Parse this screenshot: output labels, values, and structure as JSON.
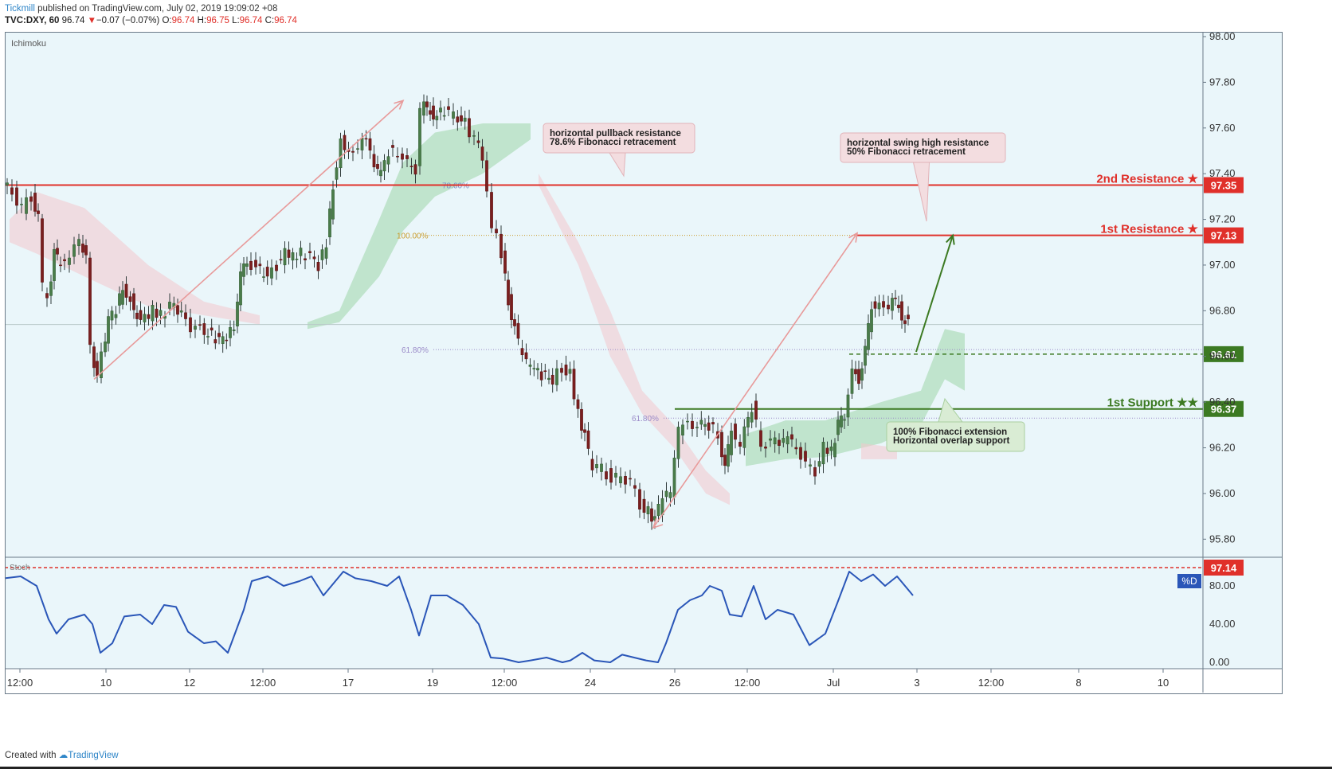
{
  "header": {
    "publisher": "Tickmill",
    "published_text": " published on TradingView.com, July 02, 2019 19:09:02 +08",
    "symbol": "TVC:DXY, 60",
    "last": "96.74",
    "arrow": "▼",
    "change": "−0.07 (−0.07%)",
    "o_label": "O:",
    "o_value": "96.74",
    "h_label": "H:",
    "h_value": "96.75",
    "l_label": "L:",
    "l_value": "96.74",
    "c_label": "C:",
    "c_value": "96.74"
  },
  "chart_data": {
    "type": "candlestick",
    "indicator_label": "Ichimoku",
    "ylim": [
      95.7,
      98.0
    ],
    "y_ticks": [
      "98.00",
      "97.80",
      "97.60",
      "97.40",
      "97.20",
      "97.00",
      "96.80",
      "96.60",
      "96.40",
      "96.20",
      "96.00",
      "95.80"
    ],
    "x_ticks": [
      "12:00",
      "10",
      "12",
      "12:00",
      "17",
      "19",
      "12:00",
      "24",
      "26",
      "12:00",
      "Jul",
      "3",
      "12:00",
      "8",
      "10"
    ],
    "series_path": [
      [
        0,
        97.35
      ],
      [
        12,
        97.32
      ],
      [
        24,
        97.25
      ],
      [
        36,
        97.3
      ],
      [
        44,
        97.2
      ],
      [
        50,
        96.9
      ],
      [
        56,
        96.85
      ],
      [
        64,
        97.05
      ],
      [
        72,
        97.0
      ],
      [
        84,
        97.05
      ],
      [
        96,
        97.1
      ],
      [
        104,
        97.05
      ],
      [
        110,
        96.65
      ],
      [
        118,
        96.5
      ],
      [
        124,
        96.6
      ],
      [
        132,
        96.75
      ],
      [
        142,
        96.8
      ],
      [
        150,
        96.9
      ],
      [
        160,
        96.85
      ],
      [
        168,
        96.78
      ],
      [
        178,
        96.76
      ],
      [
        188,
        96.8
      ],
      [
        198,
        96.78
      ],
      [
        210,
        96.82
      ],
      [
        224,
        96.8
      ],
      [
        236,
        96.73
      ],
      [
        248,
        96.72
      ],
      [
        262,
        96.69
      ],
      [
        276,
        96.67
      ],
      [
        290,
        96.72
      ],
      [
        298,
        96.95
      ],
      [
        306,
        97.03
      ],
      [
        318,
        96.98
      ],
      [
        332,
        96.96
      ],
      [
        344,
        97.0
      ],
      [
        354,
        97.05
      ],
      [
        364,
        97.03
      ],
      [
        374,
        97.05
      ],
      [
        386,
        97.03
      ],
      [
        396,
        97.0
      ],
      [
        406,
        97.1
      ],
      [
        414,
        97.35
      ],
      [
        424,
        97.55
      ],
      [
        434,
        97.5
      ],
      [
        446,
        97.52
      ],
      [
        456,
        97.55
      ],
      [
        466,
        97.42
      ],
      [
        474,
        97.4
      ],
      [
        484,
        97.5
      ],
      [
        496,
        97.5
      ],
      [
        508,
        97.44
      ],
      [
        518,
        97.42
      ],
      [
        524,
        97.68
      ],
      [
        532,
        97.7
      ],
      [
        540,
        97.65
      ],
      [
        554,
        97.67
      ],
      [
        566,
        97.66
      ],
      [
        580,
        97.62
      ],
      [
        592,
        97.55
      ],
      [
        602,
        97.48
      ],
      [
        608,
        97.3
      ],
      [
        614,
        97.15
      ],
      [
        620,
        97.16
      ],
      [
        626,
        97.05
      ],
      [
        634,
        96.85
      ],
      [
        642,
        96.72
      ],
      [
        652,
        96.6
      ],
      [
        662,
        96.55
      ],
      [
        676,
        96.52
      ],
      [
        690,
        96.5
      ],
      [
        702,
        96.55
      ],
      [
        712,
        96.52
      ],
      [
        722,
        96.35
      ],
      [
        730,
        96.25
      ],
      [
        740,
        96.1
      ],
      [
        752,
        96.12
      ],
      [
        764,
        96.05
      ],
      [
        776,
        96.08
      ],
      [
        788,
        96.05
      ],
      [
        800,
        95.95
      ],
      [
        810,
        95.92
      ],
      [
        818,
        95.88
      ],
      [
        828,
        95.98
      ],
      [
        838,
        96.0
      ],
      [
        848,
        96.28
      ],
      [
        860,
        96.3
      ],
      [
        872,
        96.3
      ],
      [
        886,
        96.3
      ],
      [
        898,
        96.26
      ],
      [
        906,
        96.1
      ],
      [
        914,
        96.28
      ],
      [
        926,
        96.22
      ],
      [
        940,
        96.38
      ],
      [
        952,
        96.22
      ],
      [
        964,
        96.22
      ],
      [
        980,
        96.24
      ],
      [
        996,
        96.22
      ],
      [
        1008,
        96.12
      ],
      [
        1020,
        96.1
      ],
      [
        1030,
        96.2
      ],
      [
        1040,
        96.18
      ],
      [
        1048,
        96.3
      ],
      [
        1056,
        96.33
      ],
      [
        1066,
        96.56
      ],
      [
        1074,
        96.5
      ],
      [
        1082,
        96.62
      ],
      [
        1090,
        96.82
      ],
      [
        1100,
        96.84
      ],
      [
        1112,
        96.82
      ],
      [
        1120,
        96.85
      ],
      [
        1128,
        96.78
      ],
      [
        1136,
        96.74
      ]
    ],
    "cloud_bands": [
      {
        "name": "green cloud 1",
        "color": "#9cd6a8",
        "upper": [
          [
            380,
            96.75
          ],
          [
            420,
            96.8
          ],
          [
            470,
            97.2
          ],
          [
            500,
            97.45
          ],
          [
            540,
            97.58
          ],
          [
            600,
            97.62
          ],
          [
            660,
            97.62
          ]
        ],
        "lower": [
          [
            380,
            96.72
          ],
          [
            420,
            96.75
          ],
          [
            470,
            96.95
          ],
          [
            500,
            97.15
          ],
          [
            540,
            97.3
          ],
          [
            600,
            97.4
          ],
          [
            660,
            97.55
          ]
        ]
      },
      {
        "name": "green cloud 2",
        "color": "#9cd6a8",
        "upper": [
          [
            930,
            96.26
          ],
          [
            980,
            96.32
          ],
          [
            1030,
            96.32
          ],
          [
            1100,
            96.4
          ],
          [
            1150,
            96.45
          ],
          [
            1180,
            96.72
          ],
          [
            1205,
            96.7
          ]
        ],
        "lower": [
          [
            930,
            96.12
          ],
          [
            980,
            96.15
          ],
          [
            1030,
            96.16
          ],
          [
            1100,
            96.22
          ],
          [
            1150,
            96.3
          ],
          [
            1180,
            96.5
          ],
          [
            1205,
            96.45
          ]
        ]
      },
      {
        "name": "red cloud 1",
        "color": "#f2c6cc",
        "upper": [
          [
            6,
            97.2
          ],
          [
            40,
            97.32
          ],
          [
            100,
            97.25
          ],
          [
            180,
            97.0
          ],
          [
            250,
            96.84
          ],
          [
            320,
            96.78
          ]
        ],
        "lower": [
          [
            6,
            97.1
          ],
          [
            40,
            97.05
          ],
          [
            100,
            96.95
          ],
          [
            180,
            96.82
          ],
          [
            250,
            96.78
          ],
          [
            320,
            96.74
          ]
        ]
      },
      {
        "name": "red cloud 2",
        "color": "#f2c6cc",
        "upper": [
          [
            670,
            97.4
          ],
          [
            720,
            97.1
          ],
          [
            760,
            96.8
          ],
          [
            800,
            96.45
          ],
          [
            840,
            96.3
          ],
          [
            880,
            96.1
          ],
          [
            910,
            96.0
          ]
        ],
        "lower": [
          [
            670,
            97.35
          ],
          [
            720,
            97.0
          ],
          [
            760,
            96.6
          ],
          [
            800,
            96.35
          ],
          [
            840,
            96.2
          ],
          [
            880,
            96.0
          ],
          [
            910,
            95.95
          ]
        ]
      },
      {
        "name": "red cloud 3",
        "color": "#f2c6cc",
        "upper": [
          [
            1075,
            96.22
          ],
          [
            1120,
            96.2
          ]
        ],
        "lower": [
          [
            1075,
            96.15
          ],
          [
            1120,
            96.15
          ]
        ]
      }
    ],
    "levels": [
      {
        "label": "2nd Resistance ★",
        "value": 97.35,
        "value_text": "97.35",
        "color": "#e0302a",
        "style": "solid"
      },
      {
        "label": "1st Resistance ★",
        "value": 97.13,
        "value_text": "97.13",
        "color": "#e0302a",
        "style": "solid"
      },
      {
        "label": "",
        "value": 96.61,
        "value_text": "96.61",
        "color": "#3c7a22",
        "style": "dashed"
      },
      {
        "label": "1st Support ★★",
        "value": 96.37,
        "value_text": "96.37",
        "color": "#3c7a22",
        "style": "solid"
      }
    ],
    "fib_labels": [
      {
        "text": "78.60%",
        "value": 97.35,
        "color": "#7a8ec8"
      },
      {
        "text": "100.00%",
        "value": 97.13,
        "color": "#c99b2a"
      },
      {
        "text": "61.80%",
        "value": 96.63,
        "color": "#9a8ac8"
      },
      {
        "text": "61.80%",
        "value": 96.33,
        "color": "#9a8ac8"
      }
    ],
    "annotations": [
      {
        "lines": [
          "horizontal pullback resistance",
          "78.6% Fibonacci retracement"
        ],
        "kind": "resistance"
      },
      {
        "lines": [
          "horizontal swing high resistance",
          "50% Fibonacci retracement"
        ],
        "kind": "resistance"
      },
      {
        "lines": [
          "100% Fibonacci extension",
          "Horizontal overlap support"
        ],
        "kind": "support"
      }
    ],
    "stoch": {
      "label": "Stoch",
      "ylim": [
        0,
        100
      ],
      "y_ticks": [
        "80.00",
        "40.00",
        "0.00"
      ],
      "current_label": "%D",
      "top_level_text": "97.14",
      "values": [
        [
          0,
          88
        ],
        [
          20,
          90
        ],
        [
          40,
          80
        ],
        [
          55,
          45
        ],
        [
          65,
          30
        ],
        [
          80,
          45
        ],
        [
          100,
          50
        ],
        [
          110,
          40
        ],
        [
          120,
          10
        ],
        [
          135,
          20
        ],
        [
          150,
          48
        ],
        [
          170,
          50
        ],
        [
          185,
          40
        ],
        [
          200,
          60
        ],
        [
          215,
          58
        ],
        [
          230,
          32
        ],
        [
          250,
          20
        ],
        [
          265,
          22
        ],
        [
          280,
          10
        ],
        [
          300,
          55
        ],
        [
          310,
          85
        ],
        [
          330,
          90
        ],
        [
          350,
          80
        ],
        [
          370,
          85
        ],
        [
          385,
          90
        ],
        [
          400,
          70
        ],
        [
          410,
          80
        ],
        [
          425,
          95
        ],
        [
          440,
          88
        ],
        [
          460,
          85
        ],
        [
          480,
          80
        ],
        [
          495,
          90
        ],
        [
          510,
          55
        ],
        [
          520,
          28
        ],
        [
          535,
          70
        ],
        [
          555,
          70
        ],
        [
          575,
          60
        ],
        [
          595,
          40
        ],
        [
          610,
          5
        ],
        [
          625,
          4
        ],
        [
          645,
          0
        ],
        [
          660,
          2
        ],
        [
          680,
          5
        ],
        [
          700,
          0
        ],
        [
          710,
          2
        ],
        [
          725,
          10
        ],
        [
          740,
          2
        ],
        [
          760,
          0
        ],
        [
          775,
          8
        ],
        [
          790,
          5
        ],
        [
          805,
          2
        ],
        [
          820,
          0
        ],
        [
          830,
          20
        ],
        [
          845,
          55
        ],
        [
          860,
          65
        ],
        [
          875,
          70
        ],
        [
          885,
          80
        ],
        [
          900,
          75
        ],
        [
          910,
          50
        ],
        [
          925,
          48
        ],
        [
          940,
          80
        ],
        [
          955,
          45
        ],
        [
          970,
          55
        ],
        [
          990,
          50
        ],
        [
          1010,
          18
        ],
        [
          1030,
          30
        ],
        [
          1045,
          62
        ],
        [
          1060,
          95
        ],
        [
          1075,
          85
        ],
        [
          1090,
          92
        ],
        [
          1105,
          80
        ],
        [
          1120,
          90
        ],
        [
          1140,
          70
        ]
      ]
    }
  },
  "footer": {
    "created_with": "Created with",
    "tv": "TradingView"
  }
}
